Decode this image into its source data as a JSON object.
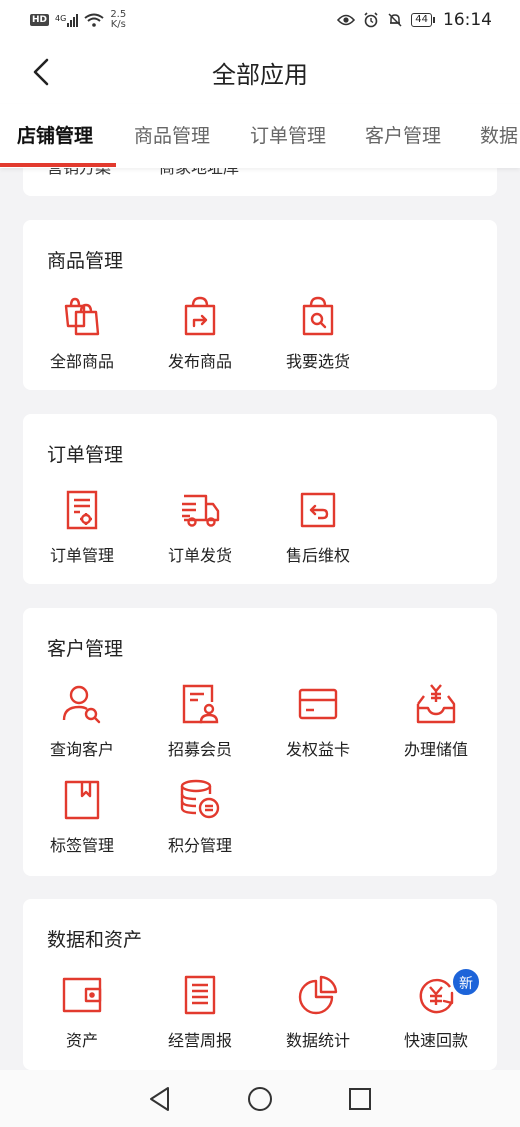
{
  "status_bar": {
    "hd": "HD",
    "net": "4G",
    "speed_value": "2.5",
    "speed_unit": "K/s",
    "battery": "44",
    "time": "16:14"
  },
  "header": {
    "title": "全部应用"
  },
  "tabs": [
    "店铺管理",
    "商品管理",
    "订单管理",
    "客户管理",
    "数据"
  ],
  "partial_row": {
    "left": "营销方案",
    "right": "商家地址库"
  },
  "sections": [
    {
      "title": "商品管理",
      "apps": [
        "全部商品",
        "发布商品",
        "我要选货"
      ]
    },
    {
      "title": "订单管理",
      "apps": [
        "订单管理",
        "订单发货",
        "售后维权"
      ]
    },
    {
      "title": "客户管理",
      "apps": [
        "查询客户",
        "招募会员",
        "发权益卡",
        "办理储值",
        "标签管理",
        "积分管理"
      ]
    },
    {
      "title": "数据和资产",
      "apps": [
        "资产",
        "经营周报",
        "数据统计",
        "快速回款"
      ],
      "badge": "新"
    }
  ],
  "colors": {
    "accent": "#e23a2e",
    "badge": "#1d64d9"
  }
}
